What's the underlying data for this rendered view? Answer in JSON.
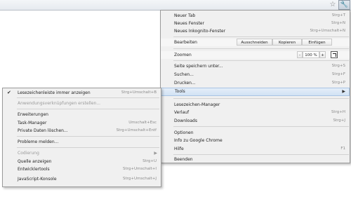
{
  "toolbar": {
    "star_icon": "star-icon",
    "wrench_icon": "wrench-icon"
  },
  "main_menu": {
    "new_tab": {
      "label": "Neuer Tab",
      "shortcut": "Strg+T"
    },
    "new_window": {
      "label": "Neues Fenster",
      "shortcut": "Strg+N"
    },
    "new_incognito": {
      "label": "Neues Inkognito-Fenster",
      "shortcut": "Strg+Umschalt+N"
    },
    "edit": {
      "label": "Bearbeiten",
      "cut": "Ausschneiden",
      "copy": "Kopieren",
      "paste": "Einfügen"
    },
    "zoom": {
      "label": "Zoomen",
      "minus": "-",
      "value": "100 %",
      "plus": "+"
    },
    "save_page": {
      "label": "Seite speichern unter...",
      "shortcut": "Strg+S"
    },
    "find": {
      "label": "Suchen...",
      "shortcut": "Strg+F"
    },
    "print": {
      "label": "Drucken...",
      "shortcut": "Strg+P"
    },
    "tools": {
      "label": "Tools"
    },
    "bookmark_manager": {
      "label": "Lesezeichen-Manager"
    },
    "history": {
      "label": "Verlauf",
      "shortcut": "Strg+H"
    },
    "downloads": {
      "label": "Downloads",
      "shortcut": "Strg+J"
    },
    "options": {
      "label": "Optionen"
    },
    "about": {
      "label": "Info zu Google Chrome"
    },
    "help": {
      "label": "Hilfe",
      "shortcut": "F1"
    },
    "exit": {
      "label": "Beenden"
    }
  },
  "tools_menu": {
    "bookmarks_bar": {
      "label": "Lesezeichenleiste immer anzeigen",
      "shortcut": "Strg+Umschalt+B",
      "checked": true
    },
    "app_shortcuts": {
      "label": "Anwendungsverknüpfungen erstellen..."
    },
    "extensions": {
      "label": "Erweiterungen"
    },
    "task_manager": {
      "label": "Task-Manager",
      "shortcut": "Umschalt+Esc"
    },
    "clear_data": {
      "label": "Private Daten löschen...",
      "shortcut": "Strg+Umschalt+Entf"
    },
    "report_issue": {
      "label": "Probleme melden..."
    },
    "encoding": {
      "label": "Codierung"
    },
    "view_source": {
      "label": "Quelle anzeigen",
      "shortcut": "Strg+U"
    },
    "dev_tools": {
      "label": "Entwicklertools",
      "shortcut": "Strg+Umschalt+I"
    },
    "js_console": {
      "label": "JavaScript-Konsole",
      "shortcut": "Strg+Umschalt+J"
    }
  }
}
